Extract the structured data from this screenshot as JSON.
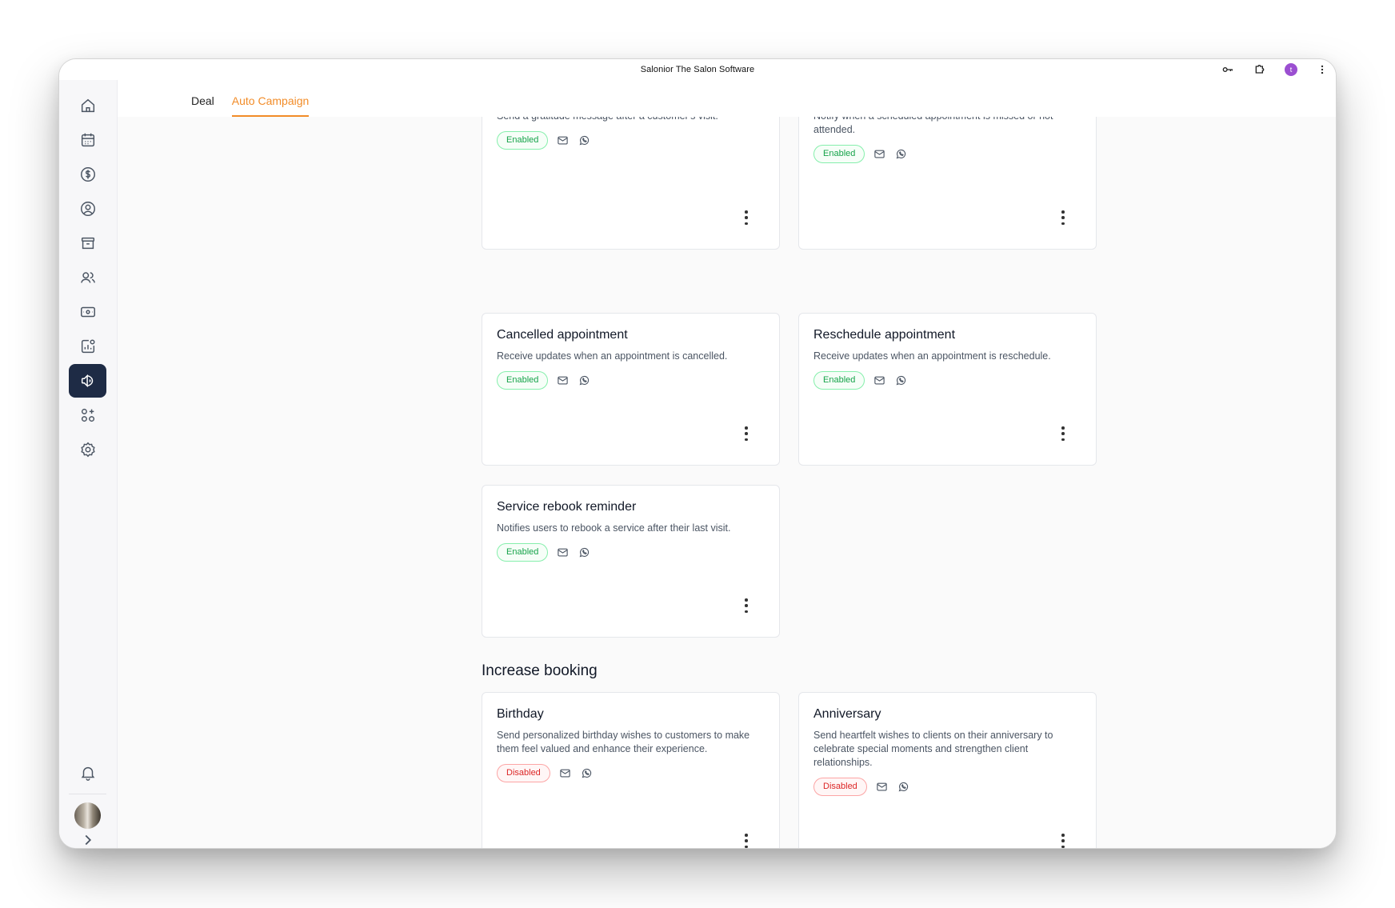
{
  "window": {
    "title": "Salonior The Salon Software",
    "avatar_letter": "t"
  },
  "sidebar": {
    "items": [
      {
        "name": "home-icon"
      },
      {
        "name": "calendar-icon"
      },
      {
        "name": "dollar-icon"
      },
      {
        "name": "user-circle-icon"
      },
      {
        "name": "archive-icon"
      },
      {
        "name": "users-icon"
      },
      {
        "name": "cash-icon"
      },
      {
        "name": "analytics-icon"
      },
      {
        "name": "megaphone-icon",
        "active": true
      },
      {
        "name": "apps-add-icon"
      },
      {
        "name": "settings-icon"
      }
    ],
    "bottom": [
      {
        "name": "bell-icon"
      },
      {
        "name": "avatar"
      },
      {
        "name": "chevron-right-icon"
      }
    ]
  },
  "tabs": [
    {
      "label": "Deal",
      "active": false
    },
    {
      "label": "Auto Campaign",
      "active": true
    }
  ],
  "cards_top": [
    {
      "title": "",
      "description": "Send a gratitude message after a customer's visit.",
      "status": "Enabled"
    },
    {
      "title": "",
      "description": "Notify when a scheduled appointment is missed or not attended.",
      "status": "Enabled"
    }
  ],
  "cards": [
    {
      "title": "Cancelled appointment",
      "description": "Receive updates when an appointment is cancelled.",
      "status": "Enabled"
    },
    {
      "title": "Reschedule appointment",
      "description": "Receive updates when an appointment is reschedule.",
      "status": "Enabled"
    },
    {
      "title": "Service rebook reminder",
      "description": "Notifies users to rebook a service after their last visit.",
      "status": "Enabled"
    }
  ],
  "increase_booking": {
    "heading": "Increase booking",
    "cards": [
      {
        "title": "Birthday",
        "description": "Send personalized birthday wishes to customers to make them feel valued and enhance their experience.",
        "status": "Disabled"
      },
      {
        "title": "Anniversary",
        "description": "Send heartfelt wishes to clients on their anniversary to celebrate special moments and strengthen client relationships.",
        "status": "Disabled"
      }
    ]
  },
  "colors": {
    "accent": "#f28c28",
    "sidebar_active": "#1e2b45",
    "enabled": "#16a34a",
    "disabled": "#dc2626"
  }
}
